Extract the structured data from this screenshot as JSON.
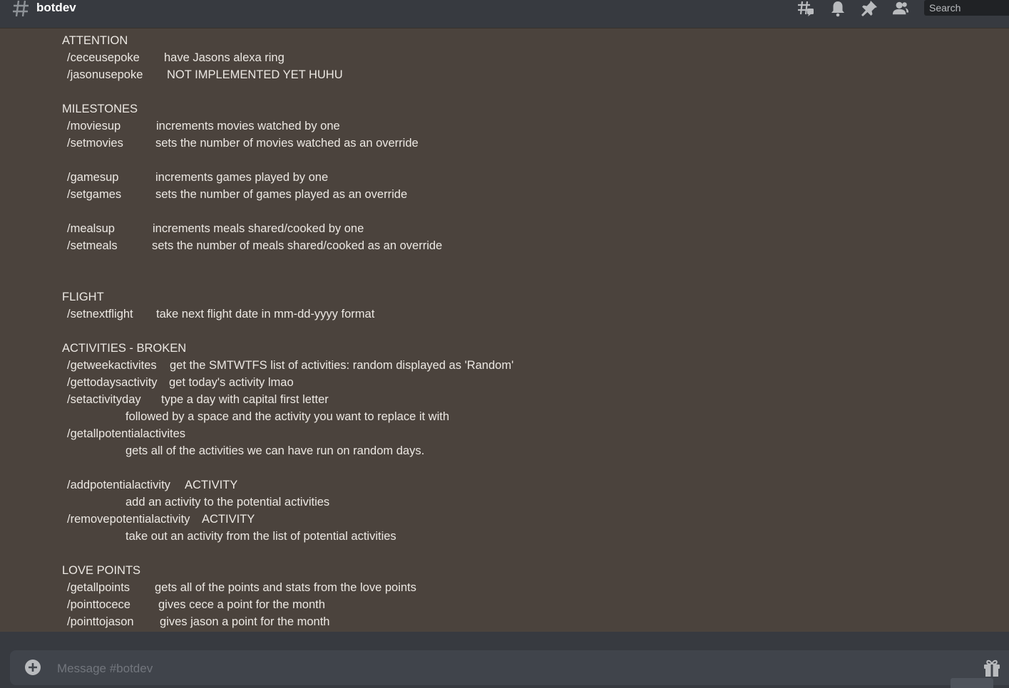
{
  "header": {
    "channel": "botdev",
    "icons": [
      "threads-icon",
      "bell-icon",
      "pin-icon",
      "members-icon"
    ],
    "search_placeholder": "Search"
  },
  "sections": {
    "attention": {
      "heading": "ATTENTION",
      "rows": [
        {
          "cmd": "/ceceusepoke",
          "desc": "have Jasons alexa ring"
        },
        {
          "cmd": "/jasonusepoke",
          "desc": "NOT IMPLEMENTED YET HUHU"
        }
      ]
    },
    "milestones": {
      "heading": "MILESTONES",
      "rows": [
        {
          "cmd": "/moviesup",
          "desc": "increments movies watched by one"
        },
        {
          "cmd": "/setmovies",
          "desc": "sets the number of movies watched as an override"
        },
        {
          "cmd": "/gamesup",
          "desc": "increments games played by one"
        },
        {
          "cmd": "/setgames",
          "desc": "sets the number of games played as an override"
        },
        {
          "cmd": "/mealsup",
          "desc": "increments meals shared/cooked by one"
        },
        {
          "cmd": "/setmeals",
          "desc": "sets the number of meals shared/cooked as an override"
        }
      ]
    },
    "flight": {
      "heading": "FLIGHT",
      "rows": [
        {
          "cmd": "/setnextflight",
          "desc": "take next flight date in mm-dd-yyyy format"
        }
      ]
    },
    "activities": {
      "heading": "ACTIVITIES - BROKEN",
      "rows": [
        {
          "cmd": "/getweekactivites",
          "desc": "get the SMTWTFS list of activities: random displayed as 'Random'"
        },
        {
          "cmd": "/gettodaysactivity",
          "desc": "get today's activity lmao"
        },
        {
          "cmd": "/setactivityday",
          "desc": "type a day with capital first letter"
        },
        {
          "cont": "followed by a space and the activity you want to replace it with"
        },
        {
          "cmd": "/getallpotentialactivites"
        },
        {
          "cont": "gets all of the activities we can have run on random days."
        },
        {
          "cmd": "/addpotentialactivity",
          "desc": "ACTIVITY"
        },
        {
          "cont": "add an activity to the potential activities"
        },
        {
          "cmd": "/removepotentialactivity",
          "desc": "ACTIVITY"
        },
        {
          "cont": "take out an activity from the list of potential activities"
        }
      ]
    },
    "love_points": {
      "heading": "LOVE POINTS",
      "rows": [
        {
          "cmd": "/getallpoints",
          "desc": "gets all of the points and stats from the love points"
        },
        {
          "cmd": "/pointtocece",
          "desc": "gives cece a point for the month"
        },
        {
          "cmd": "/pointtojason",
          "desc": "gives jason a point for the month"
        }
      ]
    }
  },
  "composer": {
    "placeholder": "Message #botdev"
  }
}
